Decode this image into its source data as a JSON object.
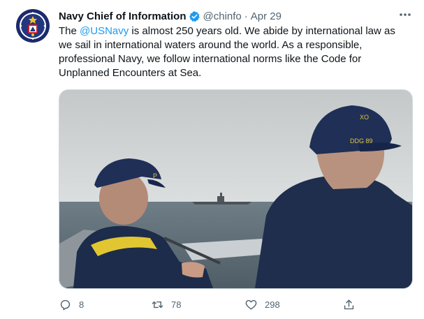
{
  "tweet": {
    "author_name": "Navy Chief of Information",
    "handle": "@chinfo",
    "separator": "·",
    "date": "Apr 29",
    "text_before": "The ",
    "mention": "@USNavy",
    "text_after": " is almost 250 years old. We abide by international law as we sail in international waters around the world. As a responsible, professional Navy, we follow international norms like the Code for Unplanned Encounters at Sea.",
    "cap_patch_left": "XO",
    "cap_patch_right": "DDG 89"
  },
  "actions": {
    "replies": "8",
    "retweets": "78",
    "likes": "298"
  },
  "icons": {
    "verified": "verified-badge-icon",
    "more": "more-options-icon",
    "reply": "reply-icon",
    "retweet": "retweet-icon",
    "like": "like-icon",
    "share": "share-icon"
  },
  "colors": {
    "verified": "#1d9bf0",
    "mention": "#1d9bf0",
    "secondary_text": "#536471"
  }
}
